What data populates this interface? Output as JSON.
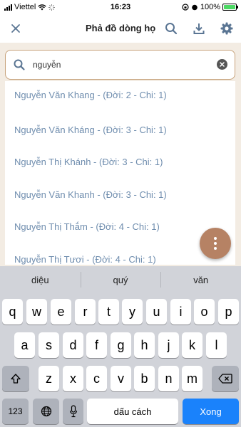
{
  "status_bar": {
    "carrier": "Viettel",
    "time": "16:23",
    "battery": "100%"
  },
  "header": {
    "title": "Phả đồ dòng họ"
  },
  "search": {
    "value": "nguyễn"
  },
  "results": [
    "Nguyễn Văn Khang - (Đời: 2 - Chi: 1)",
    "Nguyễn Văn Kháng - (Đời: 3 - Chi: 1)",
    "Nguyễn Thị Khánh - (Đời: 3 - Chi: 1)",
    "Nguyễn Văn Khanh - (Đời: 3 - Chi: 1)",
    "Nguyễn Thị Thắm - (Đời: 4 - Chi: 1)",
    "Nguyễn Thị Tươi - (Đời: 4 - Chi: 1)"
  ],
  "keyboard": {
    "suggestions": [
      "diệu",
      "quý",
      "văn"
    ],
    "row1": [
      "q",
      "w",
      "e",
      "r",
      "t",
      "y",
      "u",
      "i",
      "o",
      "p"
    ],
    "row2": [
      "a",
      "s",
      "d",
      "f",
      "g",
      "h",
      "j",
      "k",
      "l"
    ],
    "row3": [
      "z",
      "x",
      "c",
      "v",
      "b",
      "n",
      "m"
    ],
    "numbers_label": "123",
    "space_label": "dấu cách",
    "return_label": "Xong"
  },
  "colors": {
    "accent_brown": "#b68264",
    "result_text": "#6f8dae",
    "return_key": "#1a82fb"
  },
  "icons": {
    "close": "close-icon",
    "search": "search-icon",
    "download": "download-icon",
    "settings": "gear-icon",
    "clear": "clear-icon",
    "more": "more-vertical-icon",
    "shift": "shift-icon",
    "backspace": "backspace-icon",
    "globe": "globe-icon",
    "mic": "microphone-icon"
  }
}
